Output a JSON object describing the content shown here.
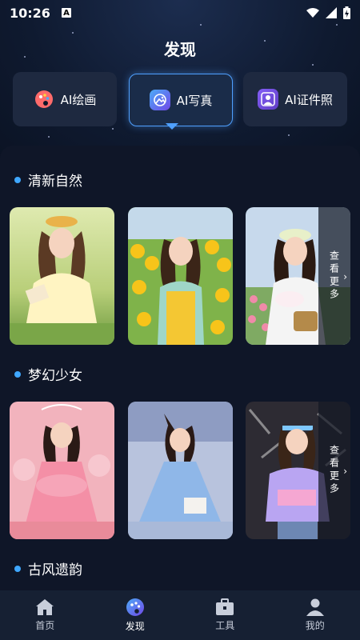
{
  "status": {
    "time": "10:26",
    "a_badge": "A"
  },
  "page": {
    "title": "发现"
  },
  "features": [
    {
      "label": "AI绘画",
      "icon": "palette-icon"
    },
    {
      "label": "AI写真",
      "icon": "photo-icon",
      "selected": true
    },
    {
      "label": "AI证件照",
      "icon": "id-photo-icon"
    }
  ],
  "sections": [
    {
      "title": "清新自然",
      "more": "查看更多"
    },
    {
      "title": "梦幻少女",
      "more": "查看更多"
    },
    {
      "title": "古风遗韵"
    }
  ],
  "nav": [
    {
      "label": "首页",
      "icon": "home-icon"
    },
    {
      "label": "发现",
      "icon": "discover-icon",
      "active": true
    },
    {
      "label": "工具",
      "icon": "toolbox-icon"
    },
    {
      "label": "我的",
      "icon": "profile-icon"
    }
  ],
  "colors": {
    "accent": "#3fa7ff",
    "panel": "#0f1628",
    "nav": "#162033"
  }
}
